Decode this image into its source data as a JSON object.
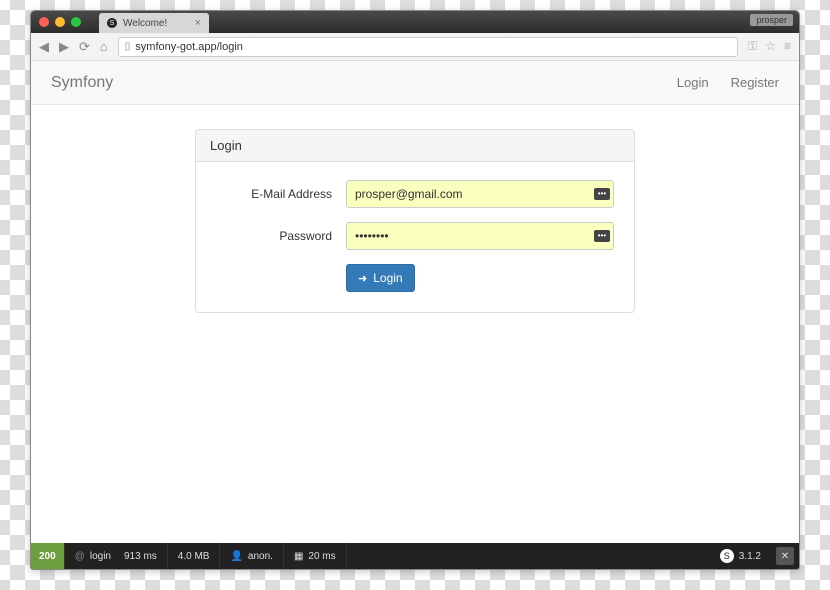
{
  "browser": {
    "tab_title": "Welcome!",
    "url": "symfony-got.app/login",
    "profile_badge": "prosper"
  },
  "app": {
    "brand": "Symfony",
    "nav": {
      "login": "Login",
      "register": "Register"
    }
  },
  "form": {
    "title": "Login",
    "email_label": "E-Mail Address",
    "email_value": "prosper@gmail.com",
    "password_label": "Password",
    "password_value": "••••••••",
    "submit_label": "Login"
  },
  "debug": {
    "status": "200",
    "route_prefix": "@",
    "route": "login",
    "time": "913 ms",
    "memory": "4.0 MB",
    "user": "anon.",
    "db_time": "20 ms",
    "version": "3.1.2"
  }
}
